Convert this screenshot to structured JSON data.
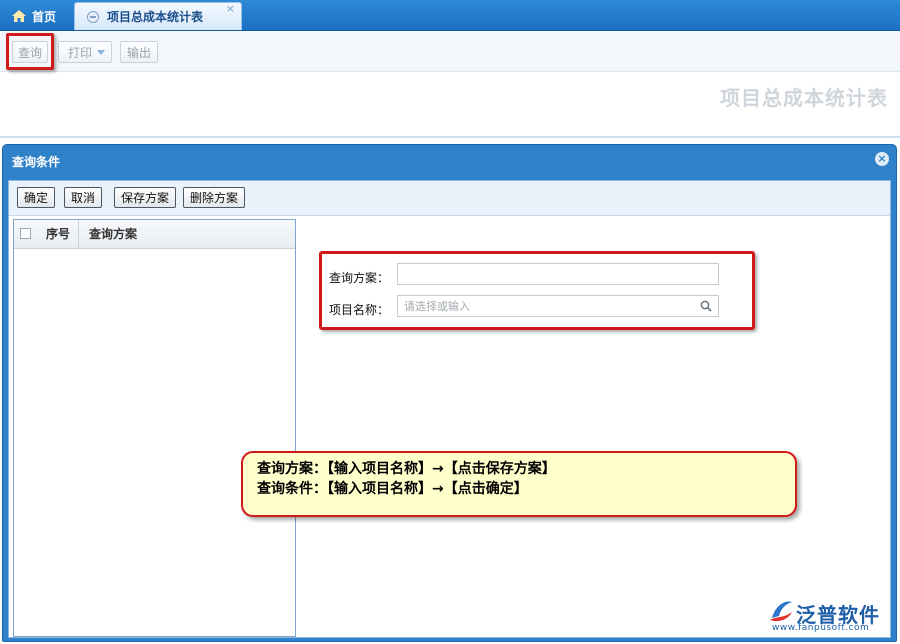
{
  "tabs": {
    "home_label": "首页",
    "report_label": "项目总成本统计表",
    "close_glyph": "×"
  },
  "toolbar": {
    "query_label": "查询",
    "print_label": "打印",
    "export_label": "输出"
  },
  "page": {
    "title": "项目总成本统计表"
  },
  "dialog": {
    "title": "查询条件",
    "close_glyph": "×",
    "buttons": {
      "ok": "确定",
      "cancel": "取消",
      "save_plan": "保存方案",
      "delete_plan": "删除方案"
    },
    "grid": {
      "col_no": "序号",
      "col_plan": "查询方案"
    },
    "form": {
      "plan_label": "查询方案：",
      "plan_value": "",
      "project_label": "项目名称：",
      "project_placeholder": "请选择或输入"
    }
  },
  "note": {
    "line1": "查询方案：【输入项目名称】→【点击保存方案】",
    "line2": "查询条件：【输入项目名称】→【点击确定】"
  },
  "logo": {
    "name": "泛普软件",
    "url": "www.fanpusoft.com"
  },
  "colors": {
    "tab_bar": "#1b6fc2",
    "dialog_header": "#2f82c9",
    "highlight": "#d0191b",
    "note_bg": "#ffffcc",
    "brand": "#1f5fa8"
  }
}
